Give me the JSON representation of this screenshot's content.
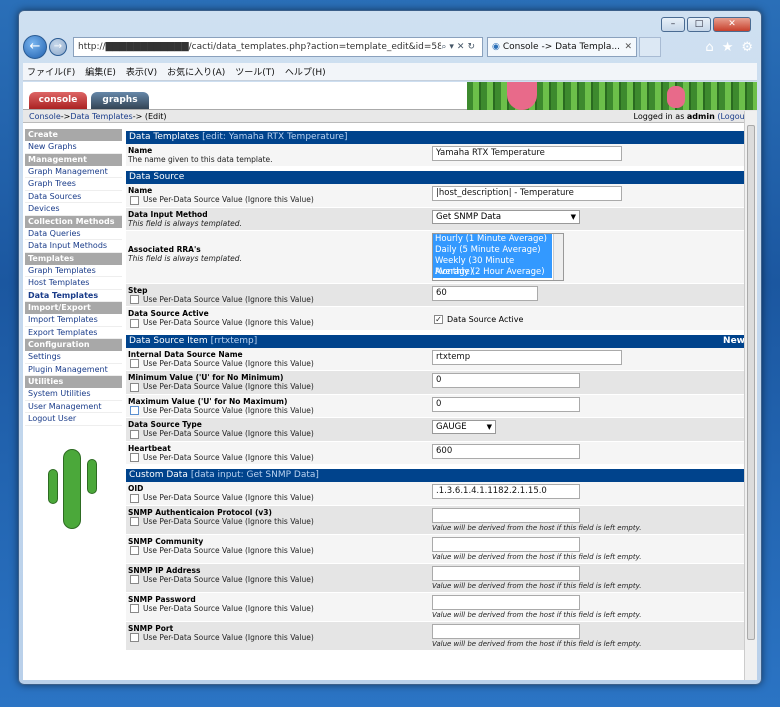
{
  "browser": {
    "url": "http://████████████/cacti/data_templates.php?action=template_edit&id=58",
    "tab_title": "Console -> Data Templa...",
    "menu": [
      "ファイル(F)",
      "編集(E)",
      "表示(V)",
      "お気に入り(A)",
      "ツール(T)",
      "ヘルプ(H)"
    ]
  },
  "cacti": {
    "tabs": [
      "console",
      "graphs"
    ],
    "breadcrumb": {
      "console": "Console",
      "sep1": " -> ",
      "templates": "Data Templates",
      "sep2": " -> (Edit)"
    },
    "login_prefix": "Logged in as ",
    "user": "admin",
    "logout": "(Logout)"
  },
  "sidebar": [
    {
      "type": "head",
      "label": "Create"
    },
    {
      "type": "item",
      "label": "New Graphs"
    },
    {
      "type": "head",
      "label": "Management"
    },
    {
      "type": "item",
      "label": "Graph Management"
    },
    {
      "type": "item",
      "label": "Graph Trees"
    },
    {
      "type": "item",
      "label": "Data Sources"
    },
    {
      "type": "item",
      "label": "Devices"
    },
    {
      "type": "head",
      "label": "Collection Methods"
    },
    {
      "type": "item",
      "label": "Data Queries"
    },
    {
      "type": "item",
      "label": "Data Input Methods"
    },
    {
      "type": "head",
      "label": "Templates"
    },
    {
      "type": "item",
      "label": "Graph Templates"
    },
    {
      "type": "item",
      "label": "Host Templates"
    },
    {
      "type": "item",
      "label": "Data Templates",
      "active": true
    },
    {
      "type": "head",
      "label": "Import/Export"
    },
    {
      "type": "item",
      "label": "Import Templates"
    },
    {
      "type": "item",
      "label": "Export Templates"
    },
    {
      "type": "head",
      "label": "Configuration"
    },
    {
      "type": "item",
      "label": "Settings"
    },
    {
      "type": "item",
      "label": "Plugin Management"
    },
    {
      "type": "head",
      "label": "Utilities"
    },
    {
      "type": "item",
      "label": "System Utilities"
    },
    {
      "type": "item",
      "label": "User Management"
    },
    {
      "type": "item",
      "label": "Logout User"
    }
  ],
  "per_ds": "Use Per-Data Source Value (Ignore this Value)",
  "templated": "This field is always templated.",
  "derived_hint": "Value will be derived from the host if this field is left empty.",
  "sec1": {
    "title": "Data Templates",
    "sub": "[edit: Yamaha RTX Temperature]",
    "name_label": "Name",
    "name_desc": "The name given to this data template.",
    "name_value": "Yamaha RTX Temperature"
  },
  "sec2": {
    "title": "Data Source",
    "name_label": "Name",
    "name_value": "|host_description| - Temperature",
    "input_label": "Data Input Method",
    "input_value": "Get SNMP Data",
    "rra_label": "Associated RRA's",
    "rra_options": [
      "Hourly (1 Minute Average)",
      "Daily (5 Minute Average)",
      "Weekly (30 Minute Average)",
      "Monthly (2 Hour Average)"
    ],
    "step_label": "Step",
    "step_value": "60",
    "active_label": "Data Source Active",
    "active_value": "Data Source Active"
  },
  "sec3": {
    "title": "Data Source Item",
    "sub": "[rrtxtemp]",
    "new": "New",
    "ids_label": "Internal Data Source Name",
    "ids_value": "rtxtemp",
    "min_label": "Minimum Value ('U' for No Minimum)",
    "min_value": "0",
    "max_label": "Maximum Value ('U' for No Maximum)",
    "max_value": "0",
    "type_label": "Data Source Type",
    "type_value": "GAUGE",
    "hb_label": "Heartbeat",
    "hb_value": "600"
  },
  "sec4": {
    "title": "Custom Data",
    "sub": "[data input: Get SNMP Data]",
    "oid_label": "OID",
    "oid_value": ".1.3.6.1.4.1.1182.2.1.15.0",
    "auth_label": "SNMP Authenticaion Protocol (v3)",
    "comm_label": "SNMP Community",
    "ip_label": "SNMP IP Address",
    "pw_label": "SNMP Password",
    "port_label": "SNMP Port"
  }
}
